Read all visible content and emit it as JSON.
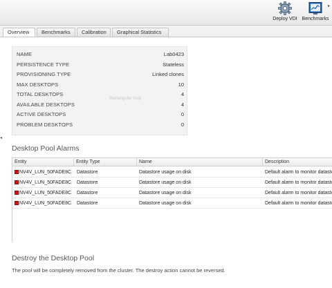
{
  "toolbar": {
    "buttons": [
      {
        "label": "Deploy VDI",
        "icon": "gear-icon"
      },
      {
        "label": "Benchmarks",
        "icon": "monitor-chart-icon"
      }
    ],
    "more_glyph": "▸"
  },
  "tabs": [
    {
      "label": "Overview",
      "active": true
    },
    {
      "label": "Benchmarks",
      "active": false
    },
    {
      "label": "Calibration",
      "active": false
    },
    {
      "label": "Graphical Statistics",
      "active": false
    }
  ],
  "summary": [
    {
      "key": "NAME",
      "value": "Lab0423"
    },
    {
      "key": "PERSISTENCE TYPE",
      "value": "Stateless"
    },
    {
      "key": "PROVISIONING TYPE",
      "value": "Linked clones"
    },
    {
      "key": "MAX DESKTOPS",
      "value": "10"
    },
    {
      "key": "TOTAL DESKTOPS",
      "value": "4"
    },
    {
      "key": "AVAILABLE DESKTOPS",
      "value": "4"
    },
    {
      "key": "ACTIVE DESKTOPS",
      "value": "0"
    },
    {
      "key": "PROBLEM DESKTOPS",
      "value": "0"
    }
  ],
  "faint_overlay": "Rectangular Snip",
  "alarms": {
    "title": "Desktop Pool Alarms",
    "columns": [
      "Entity",
      "Entity Type",
      "Name",
      "Description"
    ],
    "rows": [
      {
        "entity": "NV4V_LUN_50FADE8C...",
        "entity_type": "Datastore",
        "name": "Datastore usage on disk",
        "description": "Default alarm to monitor datastore"
      },
      {
        "entity": "NV4V_LUN_50FADE8C...",
        "entity_type": "Datastore",
        "name": "Datastore usage on disk",
        "description": "Default alarm to monitor datastore"
      },
      {
        "entity": "NV4V_LUN_50FADE8C...",
        "entity_type": "Datastore",
        "name": "Datastore usage on disk",
        "description": "Default alarm to monitor datastore"
      },
      {
        "entity": "NV4V_LUN_50FADE8C...",
        "entity_type": "Datastore",
        "name": "Datastore usage on disk",
        "description": "Default alarm to monitor datastore"
      }
    ]
  },
  "destroy": {
    "title": "Destroy the Desktop Pool",
    "text": "The pool will be completely removed from the cluster. The destroy action cannot be reversed."
  },
  "colors": {
    "alarm_red": "#cc1a1a",
    "accent_blue": "#2d6cb5"
  }
}
